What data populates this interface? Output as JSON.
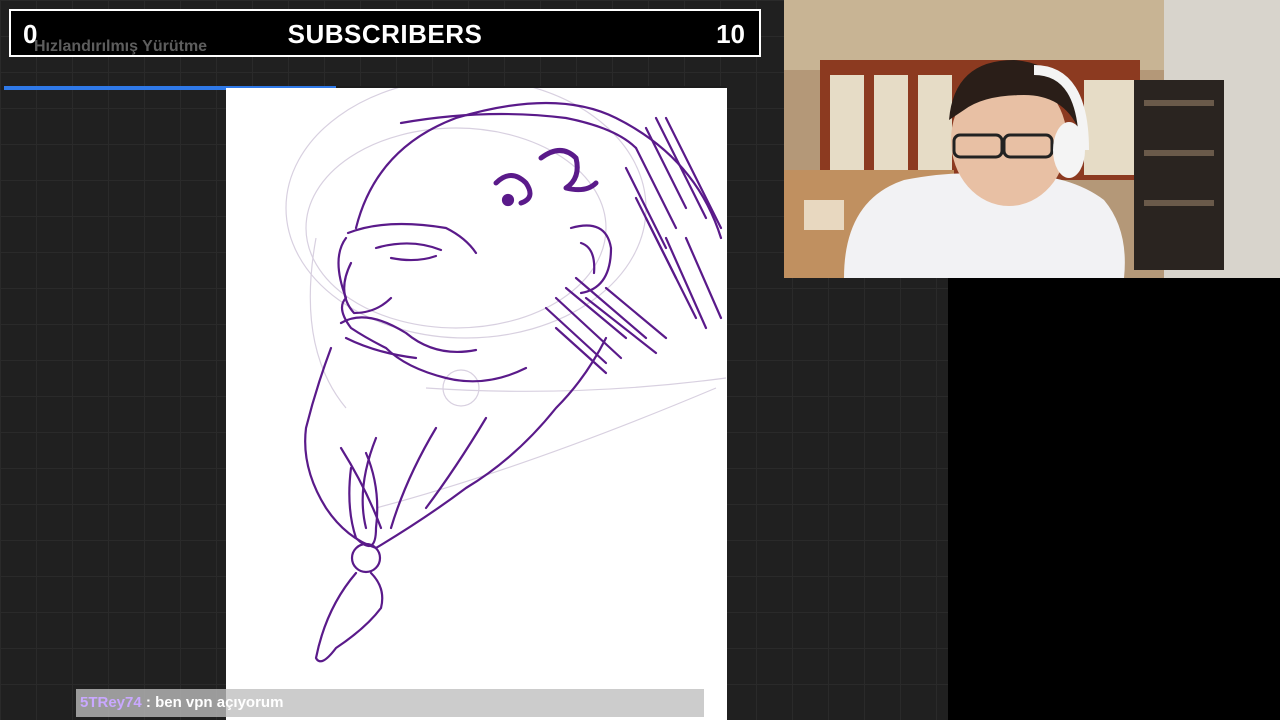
{
  "goal": {
    "current": "0",
    "label": "SUBSCRIBERS",
    "target": "10",
    "progress_fraction": 0.46
  },
  "ghost_caption": "Hızlandırılmış Yürütme",
  "chat": {
    "username": "5TRey74",
    "separator": " : ",
    "message": "ben vpn açıyorum",
    "username_color": "#c9a8ff"
  },
  "colors": {
    "progress": "#2f79e8",
    "ink": "#5a1a8a",
    "background": "#202020"
  }
}
